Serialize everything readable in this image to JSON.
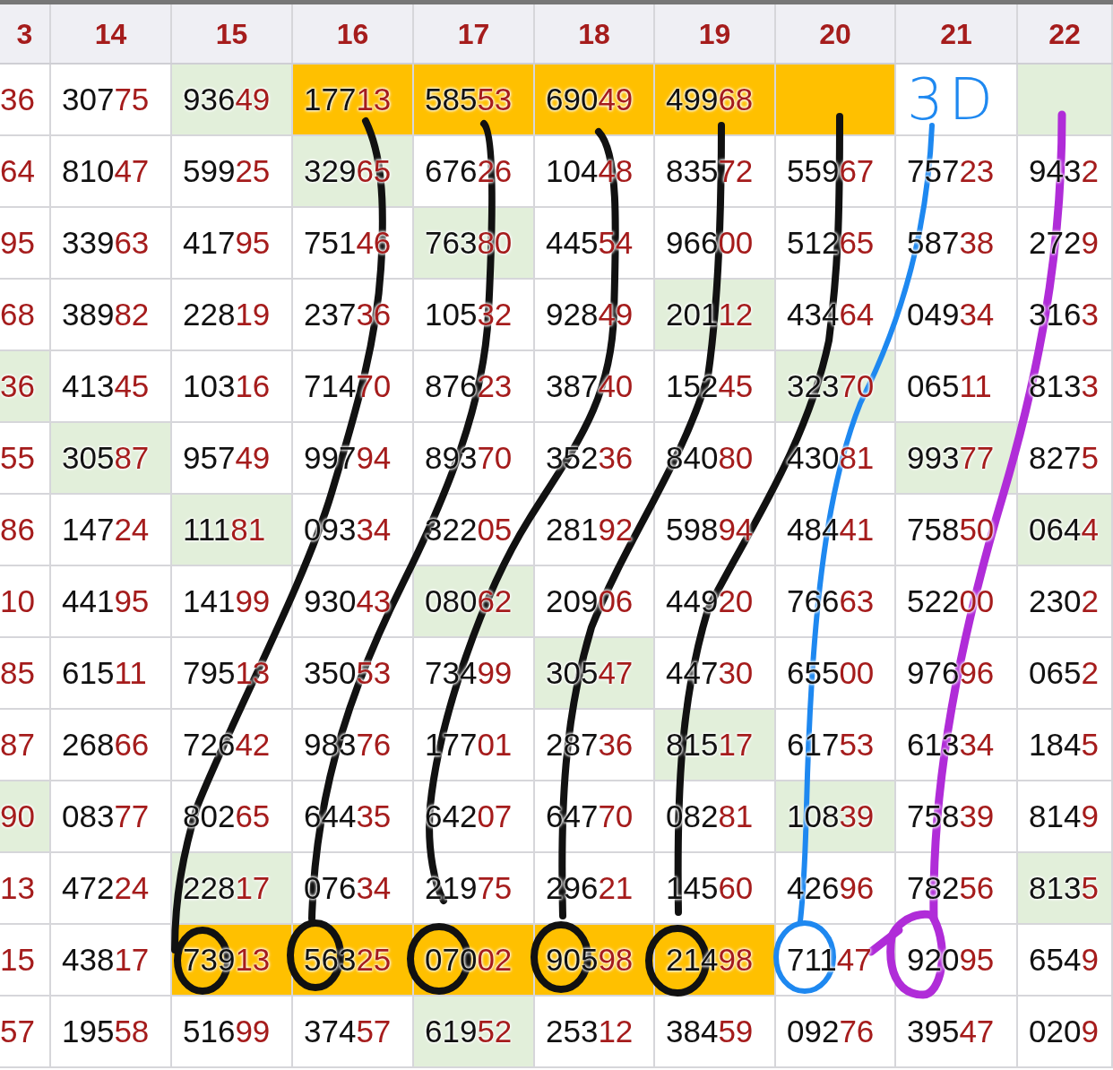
{
  "columns": [
    {
      "label": "3"
    },
    {
      "label": "14"
    },
    {
      "label": "15"
    },
    {
      "label": "16"
    },
    {
      "label": "17"
    },
    {
      "label": "18"
    },
    {
      "label": "19"
    },
    {
      "label": "20"
    },
    {
      "label": "21"
    },
    {
      "label": "22"
    }
  ],
  "rows": [
    {
      "cells": [
        {
          "tail": "36"
        },
        {
          "lead": "307",
          "tail": "75"
        },
        {
          "lead": "936",
          "tail": "49",
          "color": "#e2efda"
        },
        {
          "lead": "177",
          "tail": "13",
          "color": "#ffc000"
        },
        {
          "lead": "585",
          "tail": "53",
          "color": "#ffc000"
        },
        {
          "lead": "690",
          "tail": "49",
          "color": "#ffc000"
        },
        {
          "lead": "499",
          "tail": "68",
          "color": "#ffc000"
        },
        {
          "color": "#ffc000"
        },
        {
          "note": "3D"
        },
        {
          "color": "#e2efda"
        }
      ]
    },
    {
      "cells": [
        {
          "tail": "64"
        },
        {
          "lead": "810",
          "tail": "47"
        },
        {
          "lead": "599",
          "tail": "25"
        },
        {
          "lead": "329",
          "tail": "65",
          "color": "#e2efda"
        },
        {
          "lead": "676",
          "tail": "26"
        },
        {
          "lead": "104",
          "tail": "48"
        },
        {
          "lead": "835",
          "tail": "72"
        },
        {
          "lead": "559",
          "tail": "67"
        },
        {
          "lead": "757",
          "tail": "23"
        },
        {
          "lead": "943",
          "tail": "2"
        }
      ]
    },
    {
      "cells": [
        {
          "tail": "95"
        },
        {
          "lead": "339",
          "tail": "63"
        },
        {
          "lead": "417",
          "tail": "95"
        },
        {
          "lead": "751",
          "tail": "46"
        },
        {
          "lead": "763",
          "tail": "80",
          "color": "#e2efda"
        },
        {
          "lead": "445",
          "tail": "54"
        },
        {
          "lead": "966",
          "tail": "00"
        },
        {
          "lead": "512",
          "tail": "65"
        },
        {
          "lead": "587",
          "tail": "38"
        },
        {
          "lead": "272",
          "tail": "9"
        }
      ]
    },
    {
      "cells": [
        {
          "tail": "68"
        },
        {
          "lead": "389",
          "tail": "82"
        },
        {
          "lead": "228",
          "tail": "19"
        },
        {
          "lead": "237",
          "tail": "36"
        },
        {
          "lead": "105",
          "tail": "32"
        },
        {
          "lead": "928",
          "tail": "49"
        },
        {
          "lead": "201",
          "tail": "12",
          "color": "#e2efda"
        },
        {
          "lead": "434",
          "tail": "64"
        },
        {
          "lead": "049",
          "tail": "34"
        },
        {
          "lead": "316",
          "tail": "3"
        }
      ]
    },
    {
      "cells": [
        {
          "tail": "36",
          "color": "#e2efda"
        },
        {
          "lead": "413",
          "tail": "45"
        },
        {
          "lead": "103",
          "tail": "16"
        },
        {
          "lead": "714",
          "tail": "70"
        },
        {
          "lead": "876",
          "tail": "23"
        },
        {
          "lead": "387",
          "tail": "40"
        },
        {
          "lead": "152",
          "tail": "45"
        },
        {
          "lead": "323",
          "tail": "70",
          "color": "#e2efda"
        },
        {
          "lead": "065",
          "tail": "11"
        },
        {
          "lead": "813",
          "tail": "3"
        }
      ]
    },
    {
      "cells": [
        {
          "tail": "55"
        },
        {
          "lead": "305",
          "tail": "87",
          "color": "#e2efda"
        },
        {
          "lead": "957",
          "tail": "49"
        },
        {
          "lead": "997",
          "tail": "94"
        },
        {
          "lead": "893",
          "tail": "70"
        },
        {
          "lead": "352",
          "tail": "36"
        },
        {
          "lead": "840",
          "tail": "80"
        },
        {
          "lead": "430",
          "tail": "81"
        },
        {
          "lead": "993",
          "tail": "77",
          "color": "#e2efda"
        },
        {
          "lead": "827",
          "tail": "5"
        }
      ]
    },
    {
      "cells": [
        {
          "tail": "86"
        },
        {
          "lead": "147",
          "tail": "24"
        },
        {
          "lead": "111",
          "tail": "81",
          "color": "#e2efda"
        },
        {
          "lead": "093",
          "tail": "34"
        },
        {
          "lead": "322",
          "tail": "05"
        },
        {
          "lead": "281",
          "tail": "92"
        },
        {
          "lead": "598",
          "tail": "94"
        },
        {
          "lead": "484",
          "tail": "41"
        },
        {
          "lead": "758",
          "tail": "50"
        },
        {
          "lead": "064",
          "tail": "4",
          "color": "#e2efda"
        }
      ]
    },
    {
      "cells": [
        {
          "tail": "10"
        },
        {
          "lead": "441",
          "tail": "95"
        },
        {
          "lead": "141",
          "tail": "99"
        },
        {
          "lead": "930",
          "tail": "43"
        },
        {
          "lead": "080",
          "tail": "62",
          "color": "#e2efda"
        },
        {
          "lead": "209",
          "tail": "06"
        },
        {
          "lead": "449",
          "tail": "20"
        },
        {
          "lead": "766",
          "tail": "63"
        },
        {
          "lead": "522",
          "tail": "00"
        },
        {
          "lead": "230",
          "tail": "2"
        }
      ]
    },
    {
      "cells": [
        {
          "tail": "85"
        },
        {
          "lead": "615",
          "tail": "11"
        },
        {
          "lead": "795",
          "tail": "13"
        },
        {
          "lead": "350",
          "tail": "53"
        },
        {
          "lead": "734",
          "tail": "99"
        },
        {
          "lead": "305",
          "tail": "47",
          "color": "#e2efda"
        },
        {
          "lead": "447",
          "tail": "30"
        },
        {
          "lead": "655",
          "tail": "00"
        },
        {
          "lead": "976",
          "tail": "96"
        },
        {
          "lead": "065",
          "tail": "2"
        }
      ]
    },
    {
      "cells": [
        {
          "tail": "87"
        },
        {
          "lead": "268",
          "tail": "66"
        },
        {
          "lead": "726",
          "tail": "42"
        },
        {
          "lead": "983",
          "tail": "76"
        },
        {
          "lead": "177",
          "tail": "01"
        },
        {
          "lead": "287",
          "tail": "36"
        },
        {
          "lead": "815",
          "tail": "17",
          "color": "#e2efda"
        },
        {
          "lead": "617",
          "tail": "53"
        },
        {
          "lead": "613",
          "tail": "34"
        },
        {
          "lead": "184",
          "tail": "5"
        }
      ]
    },
    {
      "cells": [
        {
          "tail": "90",
          "color": "#e2efda"
        },
        {
          "lead": "083",
          "tail": "77"
        },
        {
          "lead": "802",
          "tail": "65"
        },
        {
          "lead": "644",
          "tail": "35"
        },
        {
          "lead": "642",
          "tail": "07"
        },
        {
          "lead": "647",
          "tail": "70"
        },
        {
          "lead": "082",
          "tail": "81"
        },
        {
          "lead": "108",
          "tail": "39",
          "color": "#e2efda"
        },
        {
          "lead": "758",
          "tail": "39"
        },
        {
          "lead": "814",
          "tail": "9"
        }
      ]
    },
    {
      "cells": [
        {
          "tail": "13"
        },
        {
          "lead": "472",
          "tail": "24"
        },
        {
          "lead": "228",
          "tail": "17",
          "color": "#e2efda"
        },
        {
          "lead": "076",
          "tail": "34"
        },
        {
          "lead": "219",
          "tail": "75"
        },
        {
          "lead": "296",
          "tail": "21"
        },
        {
          "lead": "145",
          "tail": "60"
        },
        {
          "lead": "426",
          "tail": "96"
        },
        {
          "lead": "782",
          "tail": "56"
        },
        {
          "lead": "813",
          "tail": "5",
          "color": "#e2efda"
        }
      ]
    },
    {
      "cells": [
        {
          "tail": "15"
        },
        {
          "lead": "438",
          "tail": "17"
        },
        {
          "lead": "739",
          "tail": "13",
          "color": "#ffc000"
        },
        {
          "lead": "563",
          "tail": "25",
          "color": "#ffc000"
        },
        {
          "lead": "070",
          "tail": "02",
          "color": "#ffc000"
        },
        {
          "lead": "905",
          "tail": "98",
          "color": "#ffc000"
        },
        {
          "lead": "214",
          "tail": "98",
          "color": "#ffc000"
        },
        {
          "lead": "711",
          "tail": "47"
        },
        {
          "lead": "920",
          "tail": "95"
        },
        {
          "lead": "654",
          "tail": "9"
        }
      ]
    },
    {
      "cells": [
        {
          "tail": "57"
        },
        {
          "lead": "195",
          "tail": "58"
        },
        {
          "lead": "516",
          "tail": "99"
        },
        {
          "lead": "374",
          "tail": "57"
        },
        {
          "lead": "619",
          "tail": "52",
          "color": "#e2efda"
        },
        {
          "lead": "253",
          "tail": "12"
        },
        {
          "lead": "384",
          "tail": "59"
        },
        {
          "lead": "092",
          "tail": "76"
        },
        {
          "lead": "395",
          "tail": "47"
        },
        {
          "lead": "020",
          "tail": "9"
        }
      ]
    }
  ]
}
